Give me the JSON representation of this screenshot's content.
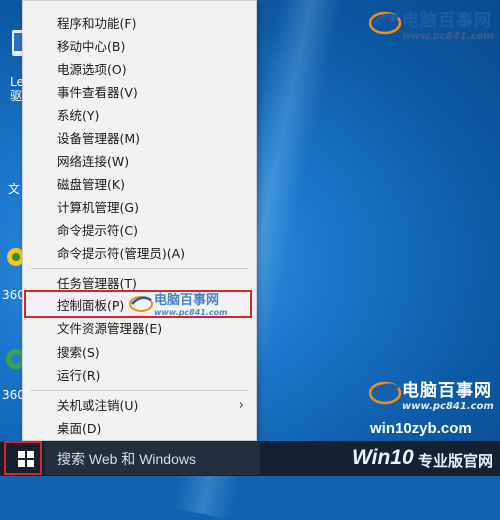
{
  "menu": {
    "items": [
      {
        "label": "程序和功能(F)"
      },
      {
        "label": "移动中心(B)"
      },
      {
        "label": "电源选项(O)"
      },
      {
        "label": "事件查看器(V)"
      },
      {
        "label": "系统(Y)"
      },
      {
        "label": "设备管理器(M)"
      },
      {
        "label": "网络连接(W)"
      },
      {
        "label": "磁盘管理(K)"
      },
      {
        "label": "计算机管理(G)"
      },
      {
        "label": "命令提示符(C)"
      },
      {
        "label": "命令提示符(管理员)(A)"
      },
      {
        "label": "任务管理器(T)"
      },
      {
        "label": "控制面板(P)"
      },
      {
        "label": "文件资源管理器(E)"
      },
      {
        "label": "搜索(S)"
      },
      {
        "label": "运行(R)"
      },
      {
        "label": "关机或注销(U)"
      },
      {
        "label": "桌面(D)"
      }
    ]
  },
  "taskbar": {
    "search_placeholder": "搜索 Web 和 Windows"
  },
  "desktop": {
    "icon1_label_a": "Ler",
    "icon1_label_b": "驱",
    "icon2_label": "文",
    "icon3_label": "360",
    "icon4_label": "360"
  },
  "watermarks": {
    "brand": "电脑百事网",
    "url": "www.pc841.com",
    "site": "win10zyb.com",
    "win10_a": "Win10",
    "win10_b": "专业版官网"
  },
  "colors": {
    "highlight": "#d9242a",
    "menu_bg": "#f2f2f2",
    "taskbar_bg": "#16212f"
  }
}
